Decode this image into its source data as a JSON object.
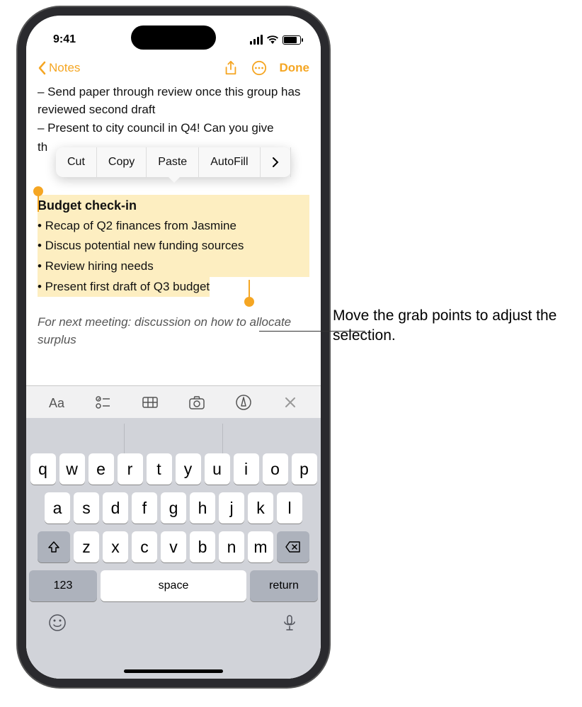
{
  "status": {
    "time": "9:41"
  },
  "nav": {
    "back_label": "Notes",
    "done_label": "Done"
  },
  "note": {
    "line1": "– Send paper through review once this group has reviewed second draft",
    "line2": "– Present to city council in Q4! Can you give",
    "line2_partial": "th",
    "selection_title": "Budget check-in",
    "sel_item1": "• Recap of Q2 finances from Jasmine",
    "sel_item2": "• Discus potential new funding sources",
    "sel_item3": "• Review hiring needs",
    "sel_item4": "• Present first draft of Q3 budget",
    "italic": "For next meeting: discussion on how to allocate surplus"
  },
  "edit_menu": {
    "cut": "Cut",
    "copy": "Copy",
    "paste": "Paste",
    "autofill": "AutoFill"
  },
  "keyboard": {
    "row1": [
      "q",
      "w",
      "e",
      "r",
      "t",
      "y",
      "u",
      "i",
      "o",
      "p"
    ],
    "row2": [
      "a",
      "s",
      "d",
      "f",
      "g",
      "h",
      "j",
      "k",
      "l"
    ],
    "row3": [
      "z",
      "x",
      "c",
      "v",
      "b",
      "n",
      "m"
    ],
    "numbers": "123",
    "space": "space",
    "return": "return"
  },
  "callout": {
    "text": "Move the grab points to adjust the selection."
  }
}
